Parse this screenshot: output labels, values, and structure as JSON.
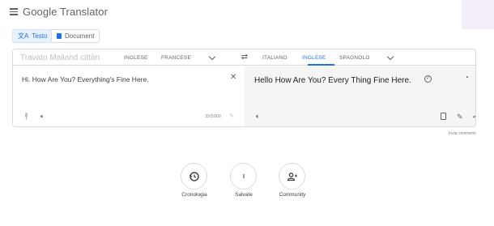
{
  "header": {
    "title": "Google Translator"
  },
  "modes": {
    "text": "Testo",
    "docs": "Document"
  },
  "source": {
    "detect_label": "Travato Maliand cittàn",
    "langs": [
      "INGLESE",
      "FRANCESE"
    ],
    "text": "Hi. How Are You? Everything's Fine Here.",
    "char_count": "32/5000"
  },
  "target": {
    "langs": [
      "ITALIANO",
      "INGLESE",
      "SPAGNOLO"
    ],
    "active_lang": "INGLESE",
    "text": "Hello How Are You? Every Thing Fine Here."
  },
  "feedback": "Invia commenti",
  "bottom": [
    {
      "label": "Cronologia",
      "icon": "history-icon"
    },
    {
      "label": "Salvate",
      "icon": "star-icon"
    },
    {
      "label": "Community",
      "icon": "community-icon"
    }
  ],
  "colors": {
    "accent": "#1a73e8",
    "target_bg": "#f5f5f5"
  }
}
